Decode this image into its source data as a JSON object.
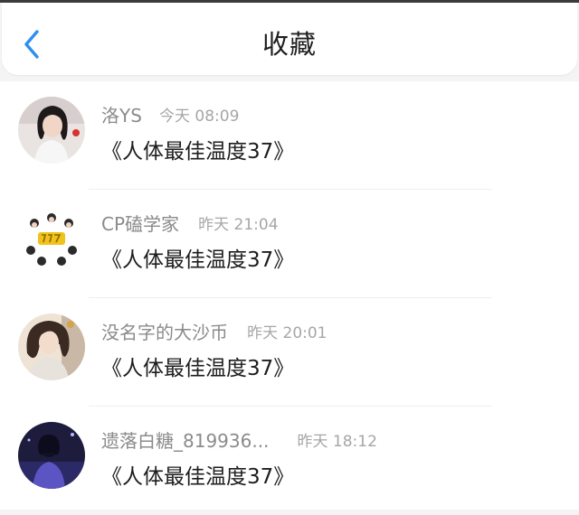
{
  "header": {
    "title": "收藏",
    "back_icon": "chevron-left-icon",
    "accent_color": "#2d8ff0"
  },
  "items": [
    {
      "username": "洛YS",
      "time": "今天 08:09",
      "title": "《人体最佳温度37》",
      "avatar": "girl-portrait-avatar"
    },
    {
      "username": "CP磕学家",
      "time": "昨天 21:04",
      "title": "《人体最佳温度37》",
      "avatar": "cartoon-sticker-avatar"
    },
    {
      "username": "没名字的大沙币",
      "time": "昨天 20:01",
      "title": "《人体最佳温度37》",
      "avatar": "illustrated-girl-avatar"
    },
    {
      "username": "遗落白糖_819936...",
      "time": "昨天 18:12",
      "title": "《人体最佳温度37》",
      "avatar": "night-silhouette-avatar"
    }
  ]
}
